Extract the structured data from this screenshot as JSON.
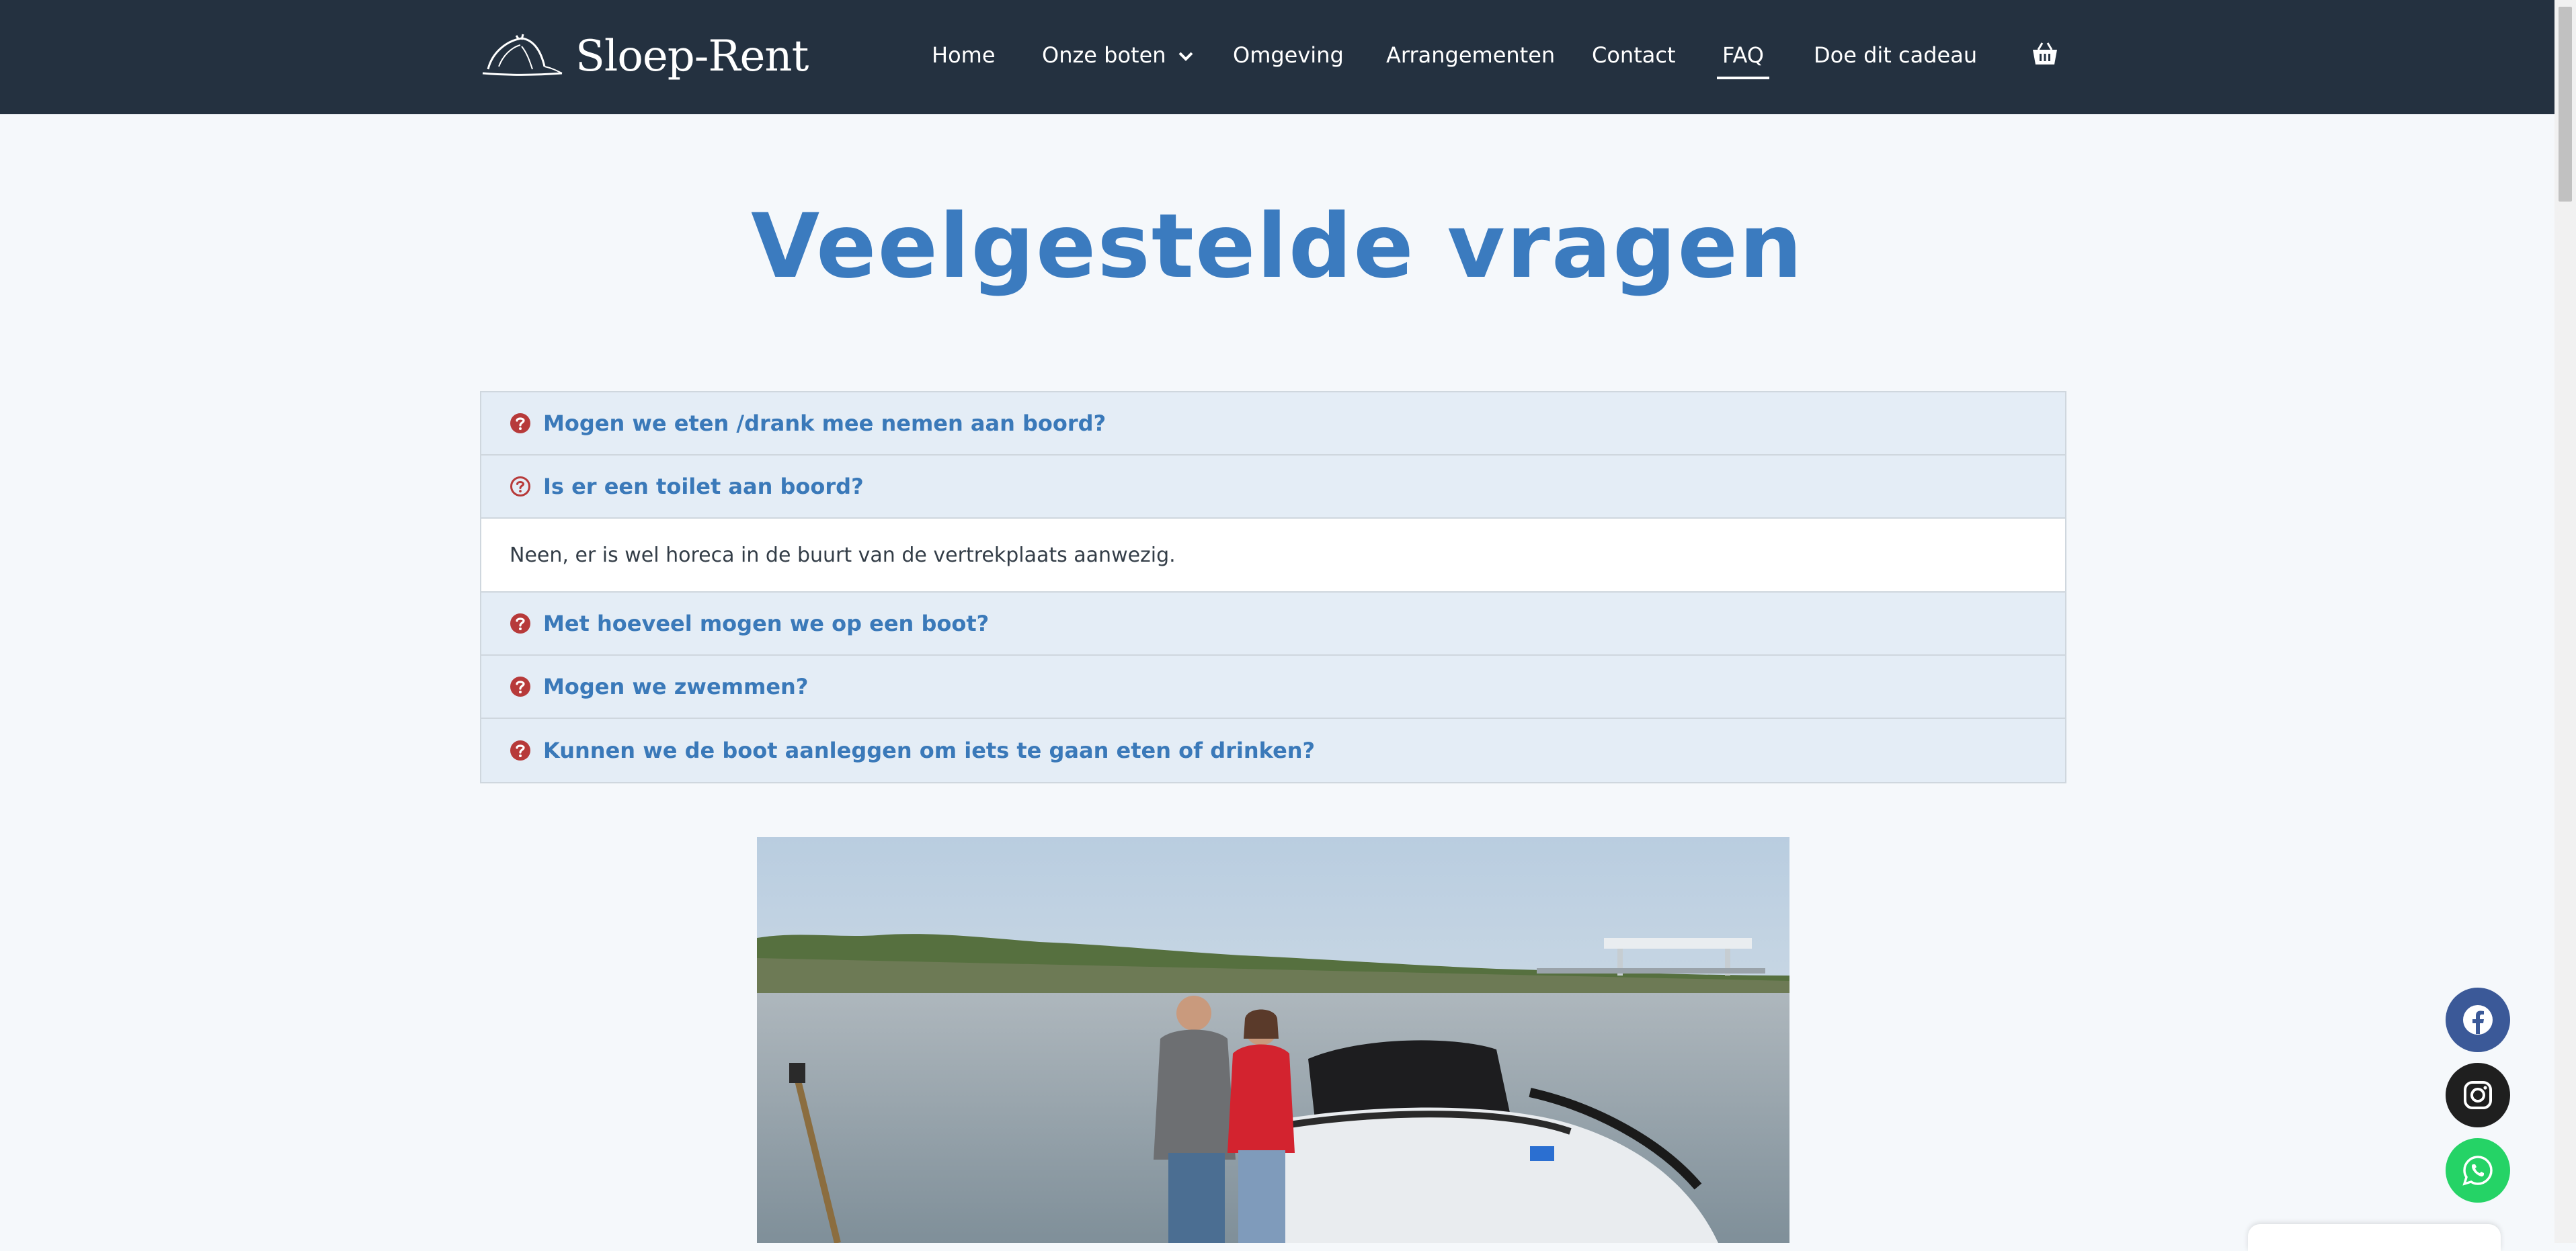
{
  "brand": {
    "name": "Sloep-Rent"
  },
  "nav": {
    "items": [
      {
        "label": "Home"
      },
      {
        "label": "Onze boten"
      },
      {
        "label": "Omgeving"
      },
      {
        "label": "Arrangementen"
      },
      {
        "label": "Contact"
      },
      {
        "label": "FAQ"
      },
      {
        "label": "Doe dit cadeau"
      }
    ],
    "active": "FAQ",
    "cart_icon": "basket-icon"
  },
  "page": {
    "title": "Veelgestelde vragen"
  },
  "faq": {
    "items": [
      {
        "question": "Mogen we eten /drank mee nemen aan boord?",
        "open": false
      },
      {
        "question": "Is er een toilet aan boord?",
        "open": true,
        "answer": "Neen, er is wel horeca in de buurt van de vertrekplaats aanwezig."
      },
      {
        "question": "Met hoeveel mogen we op een boot?",
        "open": false
      },
      {
        "question": "Mogen we zwemmen?",
        "open": false
      },
      {
        "question": "Kunnen we de boot aanleggen om iets te gaan eten of drinken?",
        "open": false
      }
    ],
    "icon_color": "#b73a3a",
    "question_color": "#3a79b9"
  },
  "social": [
    {
      "name": "facebook",
      "color": "#3b5998"
    },
    {
      "name": "instagram",
      "color": "#1f1f1f"
    },
    {
      "name": "whatsapp",
      "color": "#25d366"
    }
  ]
}
